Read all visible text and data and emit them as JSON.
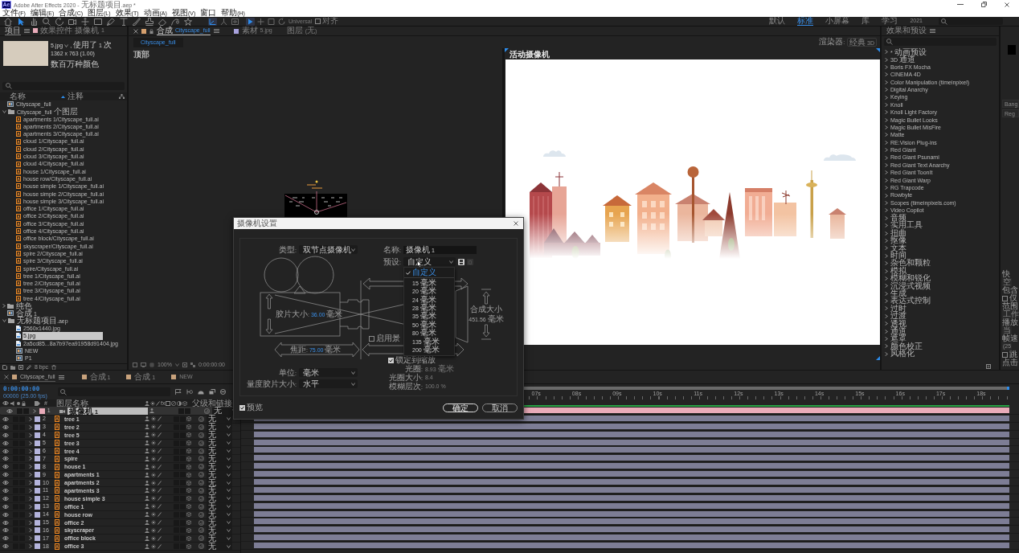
{
  "window": {
    "logo": "Ae",
    "title": "Adobe After Effects 2020 - 无标题项目.aep *"
  },
  "menu": [
    "文件(F)",
    "编辑(E)",
    "合成(C)",
    "图层(L)",
    "效果(T)",
    "动画(A)",
    "视图(V)",
    "窗口",
    "帮助(H)"
  ],
  "toolbar": {
    "tools": [
      {
        "kind": "home",
        "selected": false
      },
      {
        "kind": "pointer",
        "selected": true
      },
      {
        "kind": "hand",
        "selected": false
      },
      {
        "kind": "zoom",
        "selected": false
      },
      {
        "kind": "rotate",
        "selected": false
      },
      {
        "kind": "orbit",
        "selected": false
      },
      {
        "kind": "pan",
        "selected": false
      },
      {
        "kind": "rect",
        "selected": false
      },
      {
        "kind": "pen",
        "selected": false
      },
      {
        "kind": "text",
        "selected": false
      },
      {
        "kind": "brush",
        "selected": false
      },
      {
        "kind": "stamp",
        "selected": false
      },
      {
        "kind": "eraser",
        "selected": false
      },
      {
        "kind": "roto",
        "selected": false
      },
      {
        "kind": "pin",
        "selected": false
      }
    ],
    "axis_modes": [
      {
        "kind": "local",
        "selected": true
      },
      {
        "kind": "world",
        "selected": false
      },
      {
        "kind": "view",
        "selected": false
      }
    ],
    "transform_modes": [
      {
        "kind": "universal",
        "selected": true
      },
      {
        "kind": "position",
        "selected": false
      },
      {
        "kind": "scale",
        "selected": false
      },
      {
        "kind": "rotation",
        "selected": false
      }
    ],
    "universal": "Universal",
    "snap": {
      "label": "对齐",
      "checked": false
    },
    "workspaces": [
      {
        "label": "默认",
        "selected": false
      },
      {
        "label": "标准",
        "selected": true
      },
      {
        "label": "小屏幕",
        "selected": false
      },
      {
        "label": "库",
        "selected": false
      },
      {
        "label": "学习",
        "selected": false
      },
      {
        "label": "2021",
        "selected": false
      }
    ]
  },
  "project": {
    "tabs": [
      {
        "label": "项目",
        "selected": true
      },
      {
        "label": "效果控件 摄像机 1",
        "color": "#e9abb9",
        "selected": false
      }
    ],
    "preview": {
      "name": "5.jpg",
      "usage": ", 使用了 1 次",
      "size": "1362 x 763 (1.00)",
      "colors": "数百万种颜色"
    },
    "columns": {
      "name": "名称",
      "comment": "注释"
    },
    "items": [
      {
        "kind": "comp",
        "name": "Cityscape_full",
        "selected": false
      },
      {
        "kind": "folder",
        "name": "Cityscape_full 个图层",
        "expanded": true,
        "selected": false,
        "children": [
          {
            "kind": "ai",
            "name": "apartments 1/Cityscape_full.ai",
            "selected": false
          },
          {
            "kind": "ai",
            "name": "apartments 2/Cityscape_full.ai",
            "selected": false
          },
          {
            "kind": "ai",
            "name": "apartments 3/Cityscape_full.ai",
            "selected": false
          },
          {
            "kind": "ai",
            "name": "cloud 1/Cityscape_full.ai",
            "selected": false
          },
          {
            "kind": "ai",
            "name": "cloud 2/Cityscape_full.ai",
            "selected": false
          },
          {
            "kind": "ai",
            "name": "cloud 3/Cityscape_full.ai",
            "selected": false
          },
          {
            "kind": "ai",
            "name": "cloud 4/Cityscape_full.ai",
            "selected": false
          },
          {
            "kind": "ai",
            "name": "house 1/Cityscape_full.ai",
            "selected": false
          },
          {
            "kind": "ai",
            "name": "house row/Cityscape_full.ai",
            "selected": false
          },
          {
            "kind": "ai",
            "name": "house simple 1/Cityscape_full.ai",
            "selected": false
          },
          {
            "kind": "ai",
            "name": "house simple 2/Cityscape_full.ai",
            "selected": false
          },
          {
            "kind": "ai",
            "name": "house simple 3/Cityscape_full.ai",
            "selected": false
          },
          {
            "kind": "ai",
            "name": "office 1/Cityscape_full.ai",
            "selected": false
          },
          {
            "kind": "ai",
            "name": "office 2/Cityscape_full.ai",
            "selected": false
          },
          {
            "kind": "ai",
            "name": "office 3/Cityscape_full.ai",
            "selected": false
          },
          {
            "kind": "ai",
            "name": "office 4/Cityscape_full.ai",
            "selected": false
          },
          {
            "kind": "ai",
            "name": "office block/Cityscape_full.ai",
            "selected": false
          },
          {
            "kind": "ai",
            "name": "skyscraper/Cityscape_full.ai",
            "selected": false
          },
          {
            "kind": "ai",
            "name": "spire 2/Cityscape_full.ai",
            "selected": false
          },
          {
            "kind": "ai",
            "name": "spire 3/Cityscape_full.ai",
            "selected": false
          },
          {
            "kind": "ai",
            "name": "spire/Cityscape_full.ai",
            "selected": false
          },
          {
            "kind": "ai",
            "name": "tree 1/Cityscape_full.ai",
            "selected": false
          },
          {
            "kind": "ai",
            "name": "tree 2/Cityscape_full.ai",
            "selected": false
          },
          {
            "kind": "ai",
            "name": "tree 3/Cityscape_full.ai",
            "selected": false
          },
          {
            "kind": "ai",
            "name": "tree 4/Cityscape_full.ai",
            "selected": false
          }
        ]
      },
      {
        "kind": "folder",
        "name": "纯色",
        "expanded": false,
        "selected": false
      },
      {
        "kind": "comp",
        "name": "合成 1",
        "selected": false
      },
      {
        "kind": "folder",
        "name": "无标题项目.aep",
        "expanded": true,
        "selected": false,
        "children": [
          {
            "kind": "image",
            "name": "2560x1440.jpg",
            "selected": false
          },
          {
            "kind": "image",
            "name": "5.jpg",
            "selected": true
          },
          {
            "kind": "image",
            "name": "2a5cd85...8a7b97ea91958d91404.jpg",
            "selected": false
          },
          {
            "kind": "comp",
            "name": "NEW",
            "selected": false
          },
          {
            "kind": "comp",
            "name": "P1",
            "selected": false
          }
        ]
      }
    ],
    "footer": {
      "depth": "8 bpc"
    }
  },
  "composition": {
    "tabs": [
      {
        "type": "合成",
        "name": "Cityscape_full",
        "color": "#d6a06e",
        "selected": true
      },
      {
        "type": "素材",
        "name": "5.jpg",
        "color": "#a8a2dd",
        "selected": false
      },
      {
        "type": "图层",
        "name": "(无)",
        "selected": false
      }
    ],
    "view_tab": {
      "label": "Cityscape_full",
      "selected": true
    },
    "renderer": {
      "label": "渲染器:",
      "value": "经典 3D"
    },
    "views": [
      {
        "kind": "top",
        "label": "顶部",
        "active": false
      },
      {
        "kind": "camera",
        "label": "活动摄像机",
        "active": true
      }
    ],
    "footer": {
      "zoom": "100%",
      "time": "0:00:00:00"
    }
  },
  "effects": {
    "title": "效果和预设",
    "items": [
      {
        "label": "* 动画预设",
        "expanded": false
      },
      {
        "label": "3D 通道",
        "expanded": false
      },
      {
        "label": "Boris FX Mocha",
        "expanded": false
      },
      {
        "label": "CINEMA 4D",
        "expanded": false
      },
      {
        "label": "Color Manipulation (timeinpixel)",
        "expanded": false
      },
      {
        "label": "Digital Anarchy",
        "expanded": false
      },
      {
        "label": "Keying",
        "expanded": false
      },
      {
        "label": "Knoll",
        "expanded": false
      },
      {
        "label": "Knoll Light Factory",
        "expanded": false
      },
      {
        "label": "Magic Bullet Looks",
        "expanded": false
      },
      {
        "label": "Magic Bullet MisFire",
        "expanded": false
      },
      {
        "label": "Matte",
        "expanded": false
      },
      {
        "label": "RE:Vision Plug-ins",
        "expanded": false
      },
      {
        "label": "Red Giant",
        "expanded": false
      },
      {
        "label": "Red Giant Psunami",
        "expanded": false
      },
      {
        "label": "Red Giant Text Anarchy",
        "expanded": false
      },
      {
        "label": "Red Giant ToonIt",
        "expanded": false
      },
      {
        "label": "Red Giant Warp",
        "expanded": false
      },
      {
        "label": "RG Trapcode",
        "expanded": false
      },
      {
        "label": "Rowbyte",
        "expanded": false
      },
      {
        "label": "Scopes (timeinpixels.com)",
        "expanded": false
      },
      {
        "label": "Video Copilot",
        "expanded": false
      },
      {
        "label": "音频",
        "expanded": false
      },
      {
        "label": "实用工具",
        "expanded": false
      },
      {
        "label": "扭曲",
        "expanded": false
      },
      {
        "label": "抠像",
        "expanded": false
      },
      {
        "label": "文本",
        "expanded": false
      },
      {
        "label": "时间",
        "expanded": false
      },
      {
        "label": "杂色和颗粒",
        "expanded": false
      },
      {
        "label": "模拟",
        "expanded": false
      },
      {
        "label": "模糊和锐化",
        "expanded": false
      },
      {
        "label": "沉浸式视频",
        "expanded": false
      },
      {
        "label": "生成",
        "expanded": false
      },
      {
        "label": "表达式控制",
        "expanded": false
      },
      {
        "label": "过时",
        "expanded": false
      },
      {
        "label": "过渡",
        "expanded": false
      },
      {
        "label": "透视",
        "expanded": false
      },
      {
        "label": "通道",
        "expanded": false
      },
      {
        "label": "遮罩",
        "expanded": false
      },
      {
        "label": "颜色校正",
        "expanded": false
      },
      {
        "label": "风格化",
        "expanded": false
      }
    ]
  },
  "side_panel": {
    "font_fields": [
      "Bang",
      "Reg"
    ],
    "items": [
      {
        "kind": "label",
        "text": "快"
      },
      {
        "kind": "field",
        "text": "空"
      },
      {
        "kind": "label",
        "text": "包含"
      },
      {
        "kind": "checkbox",
        "text": "仅",
        "checked": false
      },
      {
        "kind": "label",
        "text": "范围"
      },
      {
        "kind": "field",
        "text": "工作"
      },
      {
        "kind": "label",
        "text": "播放"
      },
      {
        "kind": "field",
        "text": "当"
      },
      {
        "kind": "label",
        "text": "帧速"
      },
      {
        "kind": "field",
        "text": "(25"
      },
      {
        "kind": "checkbox",
        "text": "跳",
        "checked": false
      },
      {
        "kind": "label",
        "text": "点击"
      }
    ]
  },
  "timeline": {
    "tabs": [
      {
        "label": "Cityscape_full",
        "selected": true
      },
      {
        "label": "合成 1",
        "selected": false
      },
      {
        "label": "合成 1",
        "selected": false
      },
      {
        "label": "NEW",
        "selected": false
      }
    ],
    "time": "0:00:00:00",
    "frames": "00000 (25.00 fps)",
    "columns": {
      "number": "#",
      "name": "图层名称",
      "effects": "fx",
      "parent": "父级和链接"
    },
    "ruler": [
      "07s",
      "08s",
      "09s",
      "10s",
      "11s",
      "12s",
      "13s",
      "14s",
      "15s",
      "16s",
      "17s",
      "18s"
    ],
    "layers": [
      {
        "number": "1",
        "kind": "camera",
        "name": "摄像机 1",
        "color": "#e9abb9",
        "visible": true,
        "expanded": false,
        "selected": true,
        "parent": "无"
      },
      {
        "number": "2",
        "kind": "ai",
        "name": "tree 1",
        "color": "#b4b4dc",
        "visible": true,
        "expanded": false,
        "selected": false,
        "parent": "无"
      },
      {
        "number": "3",
        "kind": "ai",
        "name": "tree 2",
        "color": "#b4b4dc",
        "visible": true,
        "expanded": false,
        "selected": false,
        "parent": "无"
      },
      {
        "number": "4",
        "kind": "ai",
        "name": "tree 5",
        "color": "#b4b4dc",
        "visible": true,
        "expanded": false,
        "selected": false,
        "parent": "无"
      },
      {
        "number": "5",
        "kind": "ai",
        "name": "tree 3",
        "color": "#b4b4dc",
        "visible": true,
        "expanded": false,
        "selected": false,
        "parent": "无"
      },
      {
        "number": "6",
        "kind": "ai",
        "name": "tree 4",
        "color": "#b4b4dc",
        "visible": true,
        "expanded": false,
        "selected": false,
        "parent": "无"
      },
      {
        "number": "7",
        "kind": "ai",
        "name": "spire",
        "color": "#b4b4dc",
        "visible": true,
        "expanded": false,
        "selected": false,
        "parent": "无"
      },
      {
        "number": "8",
        "kind": "ai",
        "name": "house 1",
        "color": "#b4b4dc",
        "visible": true,
        "expanded": false,
        "selected": false,
        "parent": "无"
      },
      {
        "number": "9",
        "kind": "ai",
        "name": "apartments 1",
        "color": "#b4b4dc",
        "visible": true,
        "expanded": false,
        "selected": false,
        "parent": "无"
      },
      {
        "number": "10",
        "kind": "ai",
        "name": "apartments 2",
        "color": "#b4b4dc",
        "visible": true,
        "expanded": false,
        "selected": false,
        "parent": "无"
      },
      {
        "number": "11",
        "kind": "ai",
        "name": "apartments 3",
        "color": "#b4b4dc",
        "visible": true,
        "expanded": false,
        "selected": false,
        "parent": "无"
      },
      {
        "number": "12",
        "kind": "ai",
        "name": "house simple 3",
        "color": "#b4b4dc",
        "visible": true,
        "expanded": false,
        "selected": false,
        "parent": "无"
      },
      {
        "number": "13",
        "kind": "ai",
        "name": "office 1",
        "color": "#b4b4dc",
        "visible": true,
        "expanded": false,
        "selected": false,
        "parent": "无"
      },
      {
        "number": "14",
        "kind": "ai",
        "name": "house row",
        "color": "#b4b4dc",
        "visible": true,
        "expanded": false,
        "selected": false,
        "parent": "无"
      },
      {
        "number": "15",
        "kind": "ai",
        "name": "office 2",
        "color": "#b4b4dc",
        "visible": true,
        "expanded": false,
        "selected": false,
        "parent": "无"
      },
      {
        "number": "16",
        "kind": "ai",
        "name": "skyscraper",
        "color": "#b4b4dc",
        "visible": true,
        "expanded": false,
        "selected": false,
        "parent": "无"
      },
      {
        "number": "17",
        "kind": "ai",
        "name": "office block",
        "color": "#b4b4dc",
        "visible": true,
        "expanded": false,
        "selected": false,
        "parent": "无"
      },
      {
        "number": "18",
        "kind": "ai",
        "name": "office 3",
        "color": "#b4b4dc",
        "visible": true,
        "expanded": false,
        "selected": false,
        "parent": "无"
      }
    ]
  },
  "camera_dialog": {
    "title": "摄像机设置",
    "type": {
      "label": "类型:",
      "value": "双节点摄像机"
    },
    "name": {
      "label": "名称:",
      "value": "摄像机 1"
    },
    "preset": {
      "label": "预设:",
      "value": "自定义"
    },
    "preset_menu": {
      "sections": [
        [
          {
            "label": "自定义",
            "selected": true
          }
        ],
        [
          {
            "label": "15 毫米",
            "selected": false
          },
          {
            "label": "20 毫米",
            "selected": false
          },
          {
            "label": "24 毫米",
            "selected": false
          },
          {
            "label": "28 毫米",
            "selected": false
          },
          {
            "label": "35 毫米",
            "selected": false
          },
          {
            "label": "50 毫米",
            "selected": false
          },
          {
            "label": "80 毫米",
            "selected": false
          },
          {
            "label": "135 毫米",
            "selected": false
          },
          {
            "label": "200 毫米",
            "selected": false
          }
        ]
      ]
    },
    "film_size": {
      "label": "胶片大小:",
      "value": "36.00",
      "unit": "毫米"
    },
    "focal_length": {
      "label": "焦距:",
      "value": "75.00",
      "unit": "毫米"
    },
    "comp_size": {
      "label": "合成大小",
      "value": "451.56 毫米"
    },
    "depth_of_field": {
      "label": "启用景",
      "checked": false
    },
    "lock_to_zoom": {
      "label": "锁定到缩放",
      "checked": true
    },
    "aperture": {
      "label": "光圈:",
      "value": "8.93 毫米",
      "disabled": true
    },
    "f_stop": {
      "label": "光圈大小:",
      "value": "8.4",
      "disabled": true
    },
    "blur_level": {
      "label": "模糊层次:",
      "value": "100.0 %",
      "disabled": true
    },
    "units": {
      "label": "单位:",
      "value": "毫米"
    },
    "measure_film_size": {
      "label": "量度胶片大小:",
      "value": "水平"
    },
    "preview": {
      "label": "预览",
      "checked": true
    },
    "buttons": [
      {
        "label": "确定",
        "kind": "primary"
      },
      {
        "label": "取消",
        "kind": "secondary"
      }
    ]
  }
}
